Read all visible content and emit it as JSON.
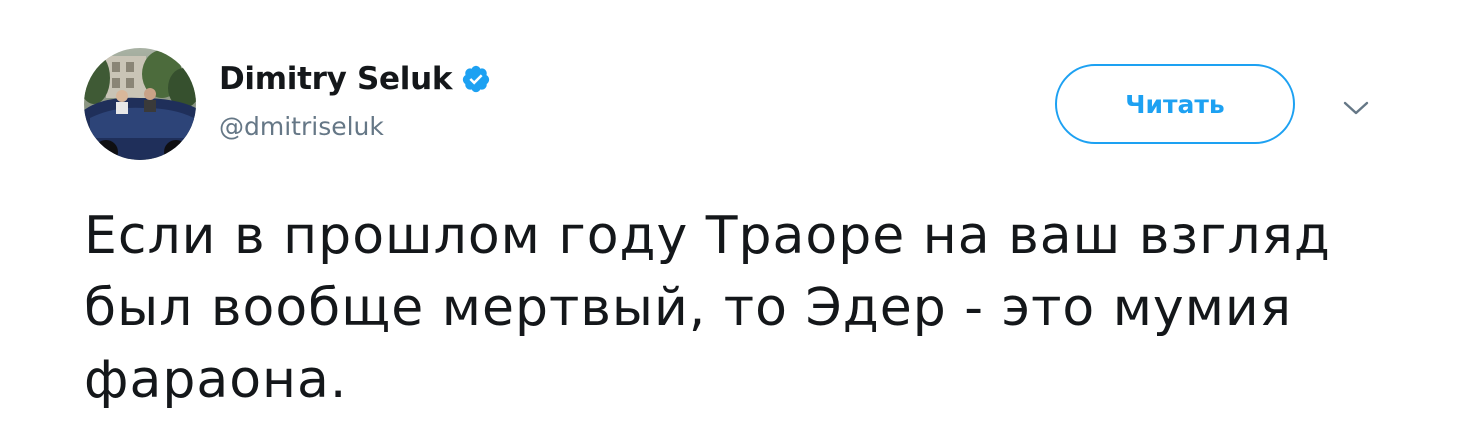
{
  "author": {
    "name": "Dimitry Seluk",
    "handle": "@dmitriseluk",
    "verified": true,
    "verified_color": "#1da1f2",
    "avatar_icon": "profile-photo"
  },
  "actions": {
    "follow_label": "Читать",
    "menu_icon": "chevron-down-icon"
  },
  "tweet": {
    "text": "Если в прошлом году Траоре на ваш взгляд\nбыл вообще мертвый, то Эдер - это мумия\nфараона."
  },
  "colors": {
    "accent": "#1da1f2",
    "text": "#14171a",
    "secondary_text": "#657786"
  }
}
